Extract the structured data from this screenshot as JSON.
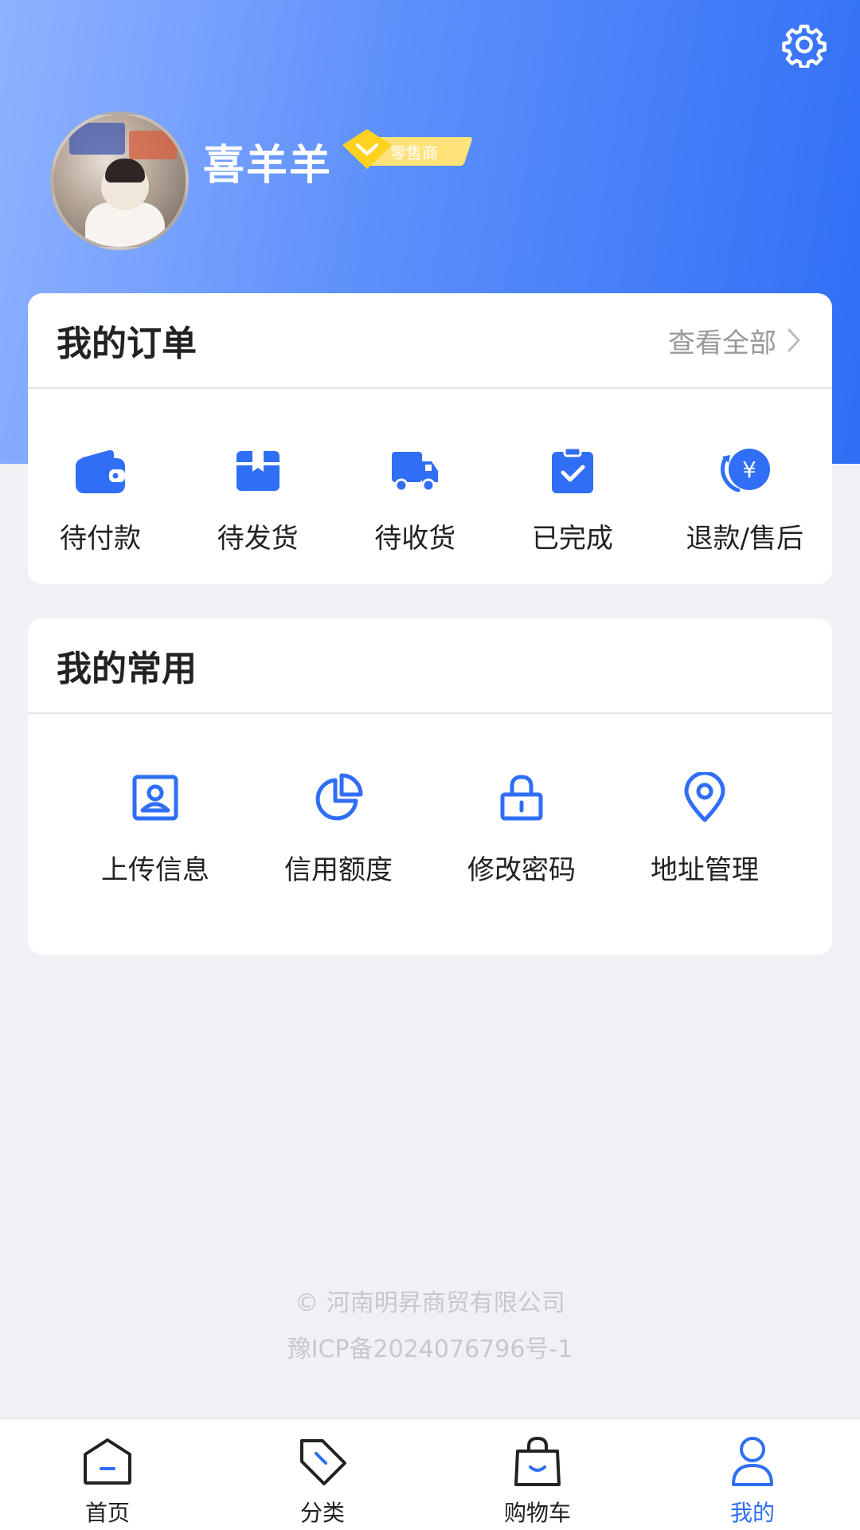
{
  "profile": {
    "username": "喜羊羊",
    "badge_label": "零售商"
  },
  "orders": {
    "title": "我的订单",
    "view_all": "查看全部",
    "items": [
      {
        "label": "待付款",
        "icon": "wallet-icon"
      },
      {
        "label": "待发货",
        "icon": "package-icon"
      },
      {
        "label": "待收货",
        "icon": "truck-icon"
      },
      {
        "label": "已完成",
        "icon": "clipboard-check-icon"
      },
      {
        "label": "退款/售后",
        "icon": "refund-yen-icon"
      }
    ]
  },
  "common": {
    "title": "我的常用",
    "items": [
      {
        "label": "上传信息",
        "icon": "id-card-icon"
      },
      {
        "label": "信用额度",
        "icon": "pie-chart-icon"
      },
      {
        "label": "修改密码",
        "icon": "lock-icon"
      },
      {
        "label": "地址管理",
        "icon": "location-pin-icon"
      }
    ]
  },
  "footer": {
    "company": "© 河南明昇商贸有限公司",
    "icp": "豫ICP备2024076796号-1"
  },
  "tabbar": {
    "items": [
      {
        "label": "首页",
        "icon": "home-icon"
      },
      {
        "label": "分类",
        "icon": "tag-icon"
      },
      {
        "label": "购物车",
        "icon": "shopping-bag-icon"
      },
      {
        "label": "我的",
        "icon": "user-icon",
        "active": true
      }
    ]
  },
  "colors": {
    "accent": "#2f6ef5",
    "badge": "#ffe27a",
    "badge_diamond": "#ffd21f"
  }
}
